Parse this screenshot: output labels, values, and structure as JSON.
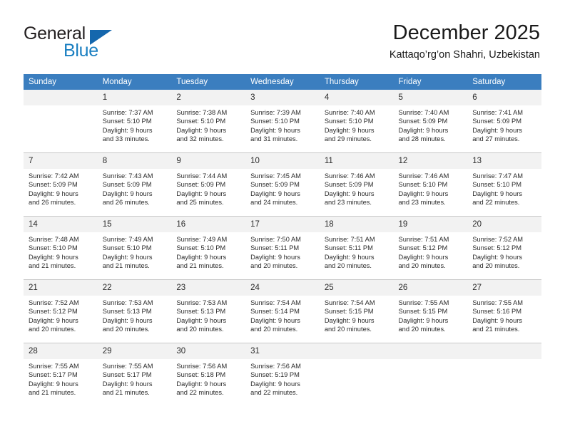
{
  "brand": {
    "word_one": "General",
    "word_two": "Blue",
    "triangle_color": "#1567ad",
    "blue_color": "#1a7fc1"
  },
  "header": {
    "title": "December 2025",
    "location": "Kattaqo’rg’on Shahri, Uzbekistan",
    "header_bg": "#3b7ebf",
    "daynum_bg": "#f2f2f2"
  },
  "weekday_headers": [
    "Sunday",
    "Monday",
    "Tuesday",
    "Wednesday",
    "Thursday",
    "Friday",
    "Saturday"
  ],
  "weeks": [
    [
      {
        "day": "",
        "blank": true,
        "sunrise": "",
        "sunset": "",
        "daylight_1": "",
        "daylight_2": ""
      },
      {
        "day": "1",
        "sunrise": "Sunrise: 7:37 AM",
        "sunset": "Sunset: 5:10 PM",
        "daylight_1": "Daylight: 9 hours",
        "daylight_2": "and 33 minutes."
      },
      {
        "day": "2",
        "sunrise": "Sunrise: 7:38 AM",
        "sunset": "Sunset: 5:10 PM",
        "daylight_1": "Daylight: 9 hours",
        "daylight_2": "and 32 minutes."
      },
      {
        "day": "3",
        "sunrise": "Sunrise: 7:39 AM",
        "sunset": "Sunset: 5:10 PM",
        "daylight_1": "Daylight: 9 hours",
        "daylight_2": "and 31 minutes."
      },
      {
        "day": "4",
        "sunrise": "Sunrise: 7:40 AM",
        "sunset": "Sunset: 5:10 PM",
        "daylight_1": "Daylight: 9 hours",
        "daylight_2": "and 29 minutes."
      },
      {
        "day": "5",
        "sunrise": "Sunrise: 7:40 AM",
        "sunset": "Sunset: 5:09 PM",
        "daylight_1": "Daylight: 9 hours",
        "daylight_2": "and 28 minutes."
      },
      {
        "day": "6",
        "sunrise": "Sunrise: 7:41 AM",
        "sunset": "Sunset: 5:09 PM",
        "daylight_1": "Daylight: 9 hours",
        "daylight_2": "and 27 minutes."
      }
    ],
    [
      {
        "day": "7",
        "sunrise": "Sunrise: 7:42 AM",
        "sunset": "Sunset: 5:09 PM",
        "daylight_1": "Daylight: 9 hours",
        "daylight_2": "and 26 minutes."
      },
      {
        "day": "8",
        "sunrise": "Sunrise: 7:43 AM",
        "sunset": "Sunset: 5:09 PM",
        "daylight_1": "Daylight: 9 hours",
        "daylight_2": "and 26 minutes."
      },
      {
        "day": "9",
        "sunrise": "Sunrise: 7:44 AM",
        "sunset": "Sunset: 5:09 PM",
        "daylight_1": "Daylight: 9 hours",
        "daylight_2": "and 25 minutes."
      },
      {
        "day": "10",
        "sunrise": "Sunrise: 7:45 AM",
        "sunset": "Sunset: 5:09 PM",
        "daylight_1": "Daylight: 9 hours",
        "daylight_2": "and 24 minutes."
      },
      {
        "day": "11",
        "sunrise": "Sunrise: 7:46 AM",
        "sunset": "Sunset: 5:09 PM",
        "daylight_1": "Daylight: 9 hours",
        "daylight_2": "and 23 minutes."
      },
      {
        "day": "12",
        "sunrise": "Sunrise: 7:46 AM",
        "sunset": "Sunset: 5:10 PM",
        "daylight_1": "Daylight: 9 hours",
        "daylight_2": "and 23 minutes."
      },
      {
        "day": "13",
        "sunrise": "Sunrise: 7:47 AM",
        "sunset": "Sunset: 5:10 PM",
        "daylight_1": "Daylight: 9 hours",
        "daylight_2": "and 22 minutes."
      }
    ],
    [
      {
        "day": "14",
        "sunrise": "Sunrise: 7:48 AM",
        "sunset": "Sunset: 5:10 PM",
        "daylight_1": "Daylight: 9 hours",
        "daylight_2": "and 21 minutes."
      },
      {
        "day": "15",
        "sunrise": "Sunrise: 7:49 AM",
        "sunset": "Sunset: 5:10 PM",
        "daylight_1": "Daylight: 9 hours",
        "daylight_2": "and 21 minutes."
      },
      {
        "day": "16",
        "sunrise": "Sunrise: 7:49 AM",
        "sunset": "Sunset: 5:10 PM",
        "daylight_1": "Daylight: 9 hours",
        "daylight_2": "and 21 minutes."
      },
      {
        "day": "17",
        "sunrise": "Sunrise: 7:50 AM",
        "sunset": "Sunset: 5:11 PM",
        "daylight_1": "Daylight: 9 hours",
        "daylight_2": "and 20 minutes."
      },
      {
        "day": "18",
        "sunrise": "Sunrise: 7:51 AM",
        "sunset": "Sunset: 5:11 PM",
        "daylight_1": "Daylight: 9 hours",
        "daylight_2": "and 20 minutes."
      },
      {
        "day": "19",
        "sunrise": "Sunrise: 7:51 AM",
        "sunset": "Sunset: 5:12 PM",
        "daylight_1": "Daylight: 9 hours",
        "daylight_2": "and 20 minutes."
      },
      {
        "day": "20",
        "sunrise": "Sunrise: 7:52 AM",
        "sunset": "Sunset: 5:12 PM",
        "daylight_1": "Daylight: 9 hours",
        "daylight_2": "and 20 minutes."
      }
    ],
    [
      {
        "day": "21",
        "sunrise": "Sunrise: 7:52 AM",
        "sunset": "Sunset: 5:12 PM",
        "daylight_1": "Daylight: 9 hours",
        "daylight_2": "and 20 minutes."
      },
      {
        "day": "22",
        "sunrise": "Sunrise: 7:53 AM",
        "sunset": "Sunset: 5:13 PM",
        "daylight_1": "Daylight: 9 hours",
        "daylight_2": "and 20 minutes."
      },
      {
        "day": "23",
        "sunrise": "Sunrise: 7:53 AM",
        "sunset": "Sunset: 5:13 PM",
        "daylight_1": "Daylight: 9 hours",
        "daylight_2": "and 20 minutes."
      },
      {
        "day": "24",
        "sunrise": "Sunrise: 7:54 AM",
        "sunset": "Sunset: 5:14 PM",
        "daylight_1": "Daylight: 9 hours",
        "daylight_2": "and 20 minutes."
      },
      {
        "day": "25",
        "sunrise": "Sunrise: 7:54 AM",
        "sunset": "Sunset: 5:15 PM",
        "daylight_1": "Daylight: 9 hours",
        "daylight_2": "and 20 minutes."
      },
      {
        "day": "26",
        "sunrise": "Sunrise: 7:55 AM",
        "sunset": "Sunset: 5:15 PM",
        "daylight_1": "Daylight: 9 hours",
        "daylight_2": "and 20 minutes."
      },
      {
        "day": "27",
        "sunrise": "Sunrise: 7:55 AM",
        "sunset": "Sunset: 5:16 PM",
        "daylight_1": "Daylight: 9 hours",
        "daylight_2": "and 21 minutes."
      }
    ],
    [
      {
        "day": "28",
        "sunrise": "Sunrise: 7:55 AM",
        "sunset": "Sunset: 5:17 PM",
        "daylight_1": "Daylight: 9 hours",
        "daylight_2": "and 21 minutes."
      },
      {
        "day": "29",
        "sunrise": "Sunrise: 7:55 AM",
        "sunset": "Sunset: 5:17 PM",
        "daylight_1": "Daylight: 9 hours",
        "daylight_2": "and 21 minutes."
      },
      {
        "day": "30",
        "sunrise": "Sunrise: 7:56 AM",
        "sunset": "Sunset: 5:18 PM",
        "daylight_1": "Daylight: 9 hours",
        "daylight_2": "and 22 minutes."
      },
      {
        "day": "31",
        "sunrise": "Sunrise: 7:56 AM",
        "sunset": "Sunset: 5:19 PM",
        "daylight_1": "Daylight: 9 hours",
        "daylight_2": "and 22 minutes."
      },
      {
        "day": "",
        "blank": true,
        "sunrise": "",
        "sunset": "",
        "daylight_1": "",
        "daylight_2": ""
      },
      {
        "day": "",
        "blank": true,
        "sunrise": "",
        "sunset": "",
        "daylight_1": "",
        "daylight_2": ""
      },
      {
        "day": "",
        "blank": true,
        "sunrise": "",
        "sunset": "",
        "daylight_1": "",
        "daylight_2": ""
      }
    ]
  ]
}
